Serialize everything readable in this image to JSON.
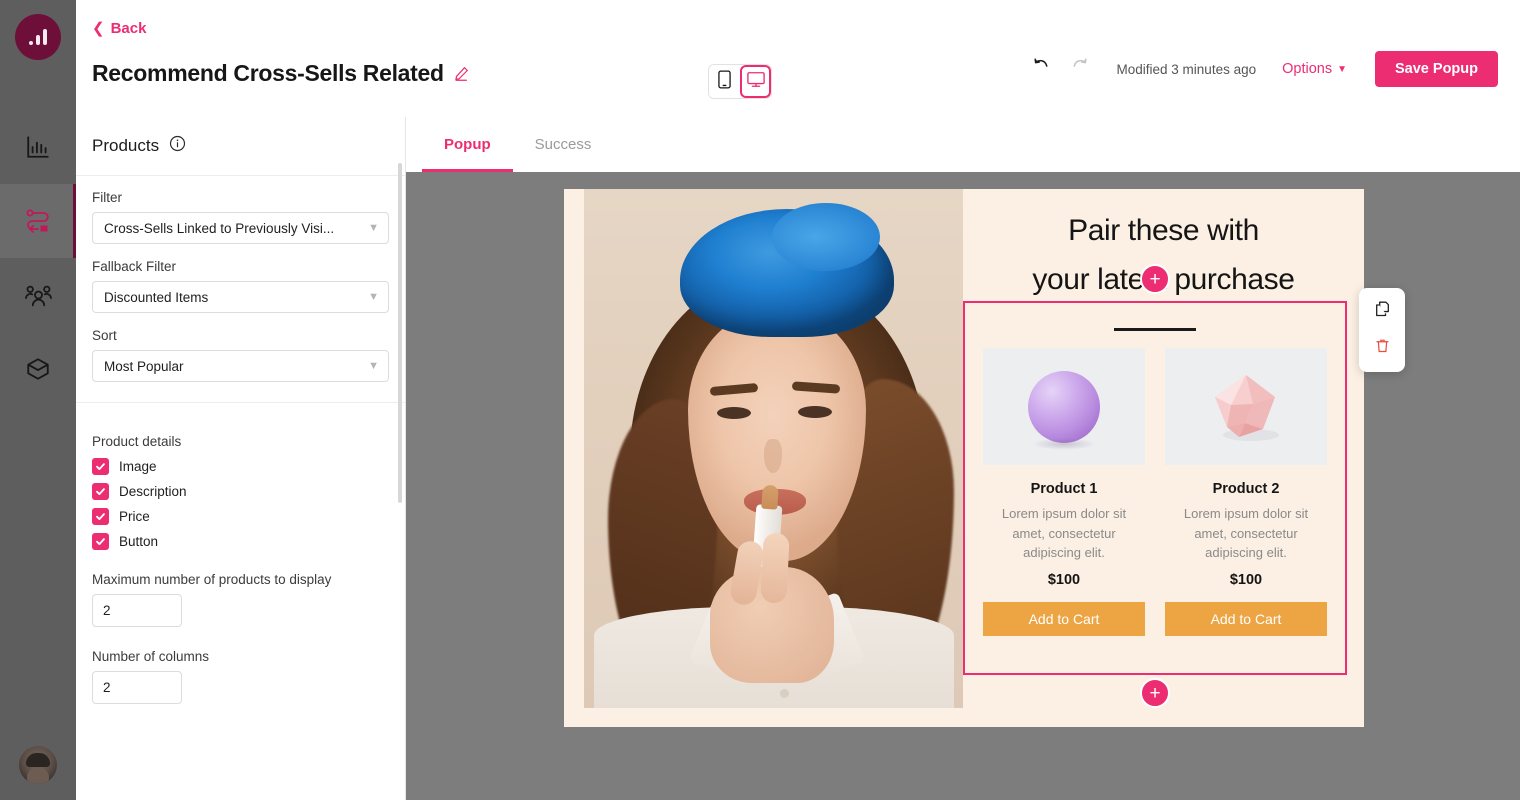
{
  "rail": {
    "logo_name": "app-logo",
    "items": [
      {
        "name": "analytics",
        "icon": "bar-chart-icon",
        "active": false
      },
      {
        "name": "journeys",
        "icon": "journey-flow-icon",
        "active": true
      },
      {
        "name": "audience",
        "icon": "people-icon",
        "active": false
      },
      {
        "name": "products",
        "icon": "box-icon",
        "active": false
      }
    ],
    "avatar_label": "User avatar"
  },
  "header": {
    "back_label": "Back",
    "title": "Recommend Cross-Sells Related",
    "edit_icon": "pencil-icon",
    "devices": [
      {
        "name": "mobile",
        "icon": "mobile-icon",
        "active": false
      },
      {
        "name": "desktop",
        "icon": "monitor-icon",
        "active": true
      }
    ],
    "undo_icon": "undo-arrow-icon",
    "redo_icon": "redo-arrow-icon",
    "modified_label": "Modified 3 minutes ago",
    "options_label": "Options",
    "options_caret": "⌄",
    "save_label": "Save Popup"
  },
  "sidebar": {
    "panel_title": "Products",
    "info_icon": "info-circle-icon",
    "fields": [
      {
        "label": "Filter",
        "value": "Cross-Sells Linked to Previously Visi..."
      },
      {
        "label": "Fallback Filter",
        "value": "Discounted Items"
      },
      {
        "label": "Sort",
        "value": "Most Popular"
      }
    ],
    "product_details_label": "Product details",
    "checkboxes": [
      {
        "label": "Image",
        "checked": true
      },
      {
        "label": "Description",
        "checked": true
      },
      {
        "label": "Price",
        "checked": true
      },
      {
        "label": "Button",
        "checked": true
      }
    ],
    "max_products_label": "Maximum number of products to display",
    "max_products_value": "2",
    "columns_label": "Number of columns",
    "columns_value": "2"
  },
  "tabs": [
    {
      "label": "Popup",
      "active": true
    },
    {
      "label": "Success",
      "active": false
    }
  ],
  "popup": {
    "heading_line1": "Pair these with",
    "heading_line2": "your latest purchase",
    "add_block_label": "+",
    "products": [
      {
        "name": "Product 1",
        "description": "Lorem ipsum dolor sit amet, consectetur adipiscing elit.",
        "price": "$100",
        "cta": "Add to Cart",
        "image": "purple-sphere"
      },
      {
        "name": "Product 2",
        "description": "Lorem ipsum dolor sit amet, consectetur adipiscing elit.",
        "price": "$100",
        "cta": "Add to Cart",
        "image": "pink-polyhedron"
      }
    ]
  },
  "element_toolbar": {
    "duplicate_icon": "duplicate-icon",
    "delete_icon": "trash-icon"
  },
  "colors": {
    "accent_pink": "#ec2d72",
    "logo_maroon": "#6d0f38",
    "rail_gray": "#5e5e5e",
    "stage_gray": "#7d7d7d",
    "popup_cream": "#fcf0e4",
    "cta_orange": "#eda443",
    "delete_red": "#e74c3c"
  }
}
